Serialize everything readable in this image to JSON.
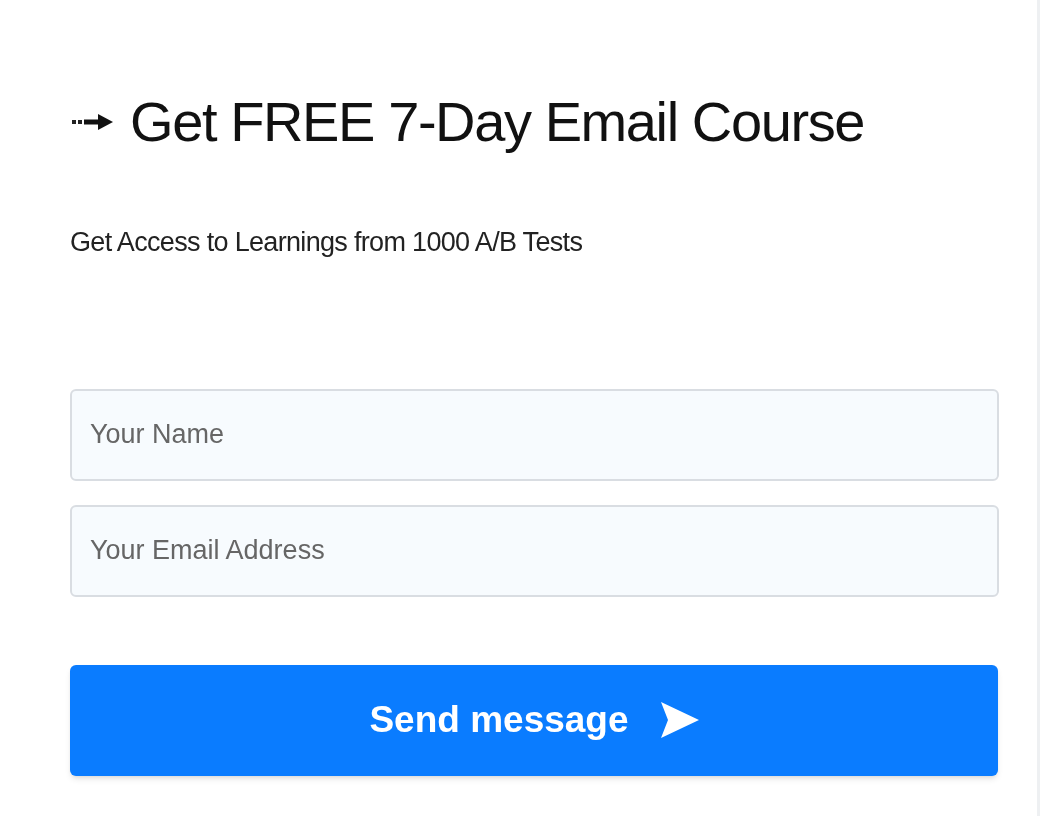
{
  "heading": "Get FREE 7-Day Email Course",
  "subtitle": "Get Access to Learnings from 1000 A/B Tests",
  "fields": [
    {
      "placeholder": "Your Name"
    },
    {
      "placeholder": "Your Email Address"
    }
  ],
  "button": {
    "label": "Send message"
  }
}
